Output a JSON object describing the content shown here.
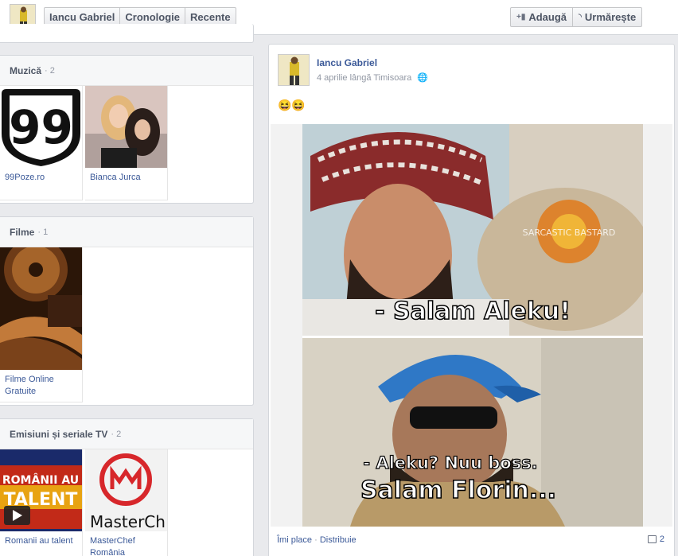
{
  "header": {
    "profile_name": "Iancu Gabriel",
    "nav": [
      {
        "label": "Cronologie"
      },
      {
        "label": "Recente"
      }
    ],
    "add_label": "Adaugă",
    "follow_label": "Urmărește"
  },
  "sections": {
    "music": {
      "title": "Muzică",
      "count": "· 2",
      "items": [
        {
          "name": "99Poze.ro",
          "logo_text": "99"
        },
        {
          "name": "Bianca Jurca"
        }
      ]
    },
    "movies": {
      "title": "Filme",
      "count": "· 1",
      "items": [
        {
          "name": "Filme Online Gratuite"
        }
      ]
    },
    "tv": {
      "title": "Emisiuni și seriale TV",
      "count": "· 2",
      "items": [
        {
          "name": "Romanii au talent",
          "banner_line1": "ROMÂNII AU",
          "banner_line2": "TALENT"
        },
        {
          "name": "MasterChef România",
          "logo_text": "MasterCh"
        }
      ]
    }
  },
  "post": {
    "author": "Iancu Gabriel",
    "date": "4 aprilie lângă Timisoara",
    "text": "😆😆",
    "image": {
      "watermark": "SARCASTIC BASTARD",
      "caption_top": "- Salam Aleku!",
      "caption_bottom_1": "- Aleku? Nuu boss.",
      "caption_bottom_2": "Salam Florin..."
    },
    "actions": {
      "like": "Îmi place",
      "share": "Distribuie",
      "comments": "2"
    }
  },
  "colors": {
    "link": "#3b5998",
    "background": "#e9eaed",
    "muted": "#9197a3"
  }
}
